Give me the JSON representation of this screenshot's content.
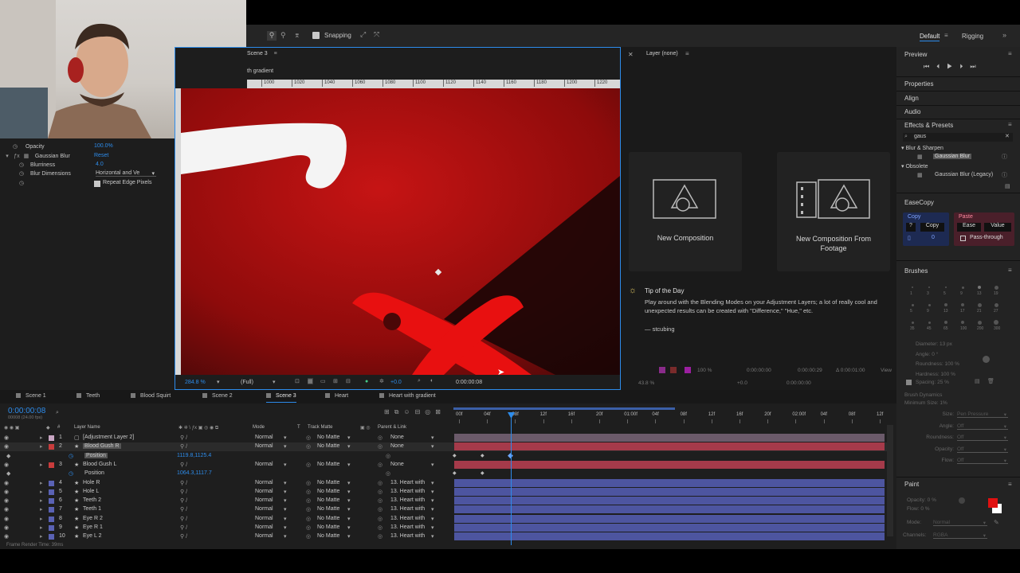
{
  "toolbar": {
    "snapping_label": "Snapping",
    "workspace_default": "Default",
    "workspace_rigging": "Rigging"
  },
  "composition_panel": {
    "tab_label": "Scene 3",
    "breadcrumb": "th gradient",
    "ruler_labels": [
      "1000",
      "1020",
      "1040",
      "1060",
      "1080",
      "1100",
      "1120",
      "1140",
      "1160",
      "1180",
      "1200",
      "1220"
    ],
    "zoom": "284.8 %",
    "resolution": "(Full)",
    "exposure": "+0.0",
    "timecode": "0:00:00:08"
  },
  "effect_controls": {
    "opacity_label": "Opacity",
    "opacity_value": "100.0%",
    "effect_name": "Gaussian Blur",
    "reset_label": "Reset",
    "blurriness_label": "Blurriness",
    "blurriness_value": "4.0",
    "blur_dimensions_label": "Blur Dimensions",
    "blur_dimensions_value": "Horizontal and Ve",
    "repeat_edge_label": "Repeat Edge Pixels"
  },
  "layer_panel": {
    "tab_label": "Layer (none)",
    "cards": [
      {
        "label": "New Composition"
      },
      {
        "label": "New Composition From Footage"
      }
    ],
    "tip_title": "Tip of the Day",
    "tip_text": "Play around with the Blending Modes on your Adjustment Layers; a lot of really cool and unexpected results can be created with \"Difference,\" \"Hue,\" etc.",
    "tip_author": "— stcubing",
    "footer_zoom": "100 %",
    "footer_time_start": "0:00:00:00",
    "footer_time_end": "0:00:00:29",
    "footer_duration": "Δ 0:00:01:00",
    "footer_view": "View",
    "footer2_zoom": "43.8 %",
    "footer2_exposure": "+0.0",
    "footer2_timecode": "0:00:00:00"
  },
  "right_panel": {
    "preview": "Preview",
    "properties": "Properties",
    "align": "Align",
    "audio": "Audio",
    "effects_presets": "Effects & Presets",
    "search_value": "gaus",
    "category_blur": "Blur & Sharpen",
    "item_gaussian": "Gaussian Blur",
    "category_obsolete": "Obsolete",
    "item_gaussian_legacy": "Gaussian Blur (Legacy)",
    "easecopy": "EaseCopy",
    "copy_header": "Copy",
    "copy_button": "Copy",
    "question": "?",
    "copy_count": "0",
    "paste_header": "Paste",
    "ease_button": "Ease",
    "value_button": "Value",
    "pass_through": "Pass-through",
    "brushes": "Brushes",
    "brush_sizes": [
      "1",
      "3",
      "5",
      "9",
      "13",
      "19",
      "5",
      "9",
      "13",
      "17",
      "21",
      "27",
      "35",
      "45",
      "65",
      "100",
      "200",
      "300"
    ],
    "diameter": "Diameter: 13 px",
    "angle": "Angle: 0 °",
    "roundness": "Roundness: 100 %",
    "hardness": "Hardness: 100 %",
    "spacing": "Spacing: 25 %",
    "brush_dynamics": "Brush Dynamics",
    "min_size_label": "Minimum Size: 1%",
    "dyn_rows": [
      {
        "label": "Size:",
        "value": "Pen Pressure"
      },
      {
        "label": "Angle:",
        "value": "Off"
      },
      {
        "label": "Roundness:",
        "value": "Off"
      },
      {
        "label": "Opacity:",
        "value": "Off"
      },
      {
        "label": "Flow:",
        "value": "Off"
      }
    ],
    "paint": "Paint",
    "paint_opacity": "Opacity: 0 %",
    "paint_flow": "Flow: 0 %",
    "paint_mode_label": "Mode:",
    "paint_mode_value": "Normal",
    "paint_channels_label": "Channels:",
    "paint_channels_value": "RGBA",
    "paint_color": "#e01010"
  },
  "timeline": {
    "tabs": [
      "Scene 1",
      "Teeth",
      "Blood Squirt",
      "Scene 2",
      "Scene 3",
      "Heart",
      "Heart with gradient"
    ],
    "timecode": "0:00:00:08",
    "fps": "00008 (24.00 fps)",
    "col_layer_name": "Layer Name",
    "col_mode": "Mode",
    "col_t": "T",
    "col_track_matte": "Track Matte",
    "col_parent": "Parent & Link",
    "ruler_labels": [
      "00f",
      "04f",
      "08f",
      "12f",
      "16f",
      "20f",
      "01:00f",
      "04f",
      "08f",
      "12f",
      "16f",
      "20f",
      "02:00f",
      "04f",
      "08f",
      "12f"
    ],
    "layers": [
      {
        "num": "1",
        "name": "[Adjustment Layer 2]",
        "mode": "Normal",
        "matte": "No Matte",
        "parent": "None",
        "color": "#c9a6c4"
      },
      {
        "num": "2",
        "name": "Blood Gush R",
        "mode": "Normal",
        "matte": "No Matte",
        "parent": "None",
        "color": "#c93c3c"
      },
      {
        "num": "",
        "name": "Position",
        "value": "1119.8,1125.4",
        "sub": true
      },
      {
        "num": "3",
        "name": "Blood Gush L",
        "mode": "Normal",
        "matte": "No Matte",
        "parent": "None",
        "color": "#c93c3c"
      },
      {
        "num": "",
        "name": "Position",
        "value": "1064.3,1117.7",
        "sub": true
      },
      {
        "num": "4",
        "name": "Hole R",
        "mode": "Normal",
        "matte": "No Matte",
        "parent": "13. Heart with",
        "color": "#5a62b4"
      },
      {
        "num": "5",
        "name": "Hole L",
        "mode": "Normal",
        "matte": "No Matte",
        "parent": "13. Heart with",
        "color": "#5a62b4"
      },
      {
        "num": "6",
        "name": "Teeth 2",
        "mode": "Normal",
        "matte": "No Matte",
        "parent": "13. Heart with",
        "color": "#5a62b4"
      },
      {
        "num": "7",
        "name": "Teeth 1",
        "mode": "Normal",
        "matte": "No Matte",
        "parent": "13. Heart with",
        "color": "#5a62b4"
      },
      {
        "num": "8",
        "name": "Eye R 2",
        "mode": "Normal",
        "matte": "No Matte",
        "parent": "13. Heart with",
        "color": "#5a62b4"
      },
      {
        "num": "9",
        "name": "Eye R 1",
        "mode": "Normal",
        "matte": "No Matte",
        "parent": "13. Heart with",
        "color": "#5a62b4"
      },
      {
        "num": "10",
        "name": "Eye L 2",
        "mode": "Normal",
        "matte": "No Matte",
        "parent": "13. Heart with",
        "color": "#5a62b4"
      }
    ],
    "footer": "Frame Render Time: 39ms"
  }
}
